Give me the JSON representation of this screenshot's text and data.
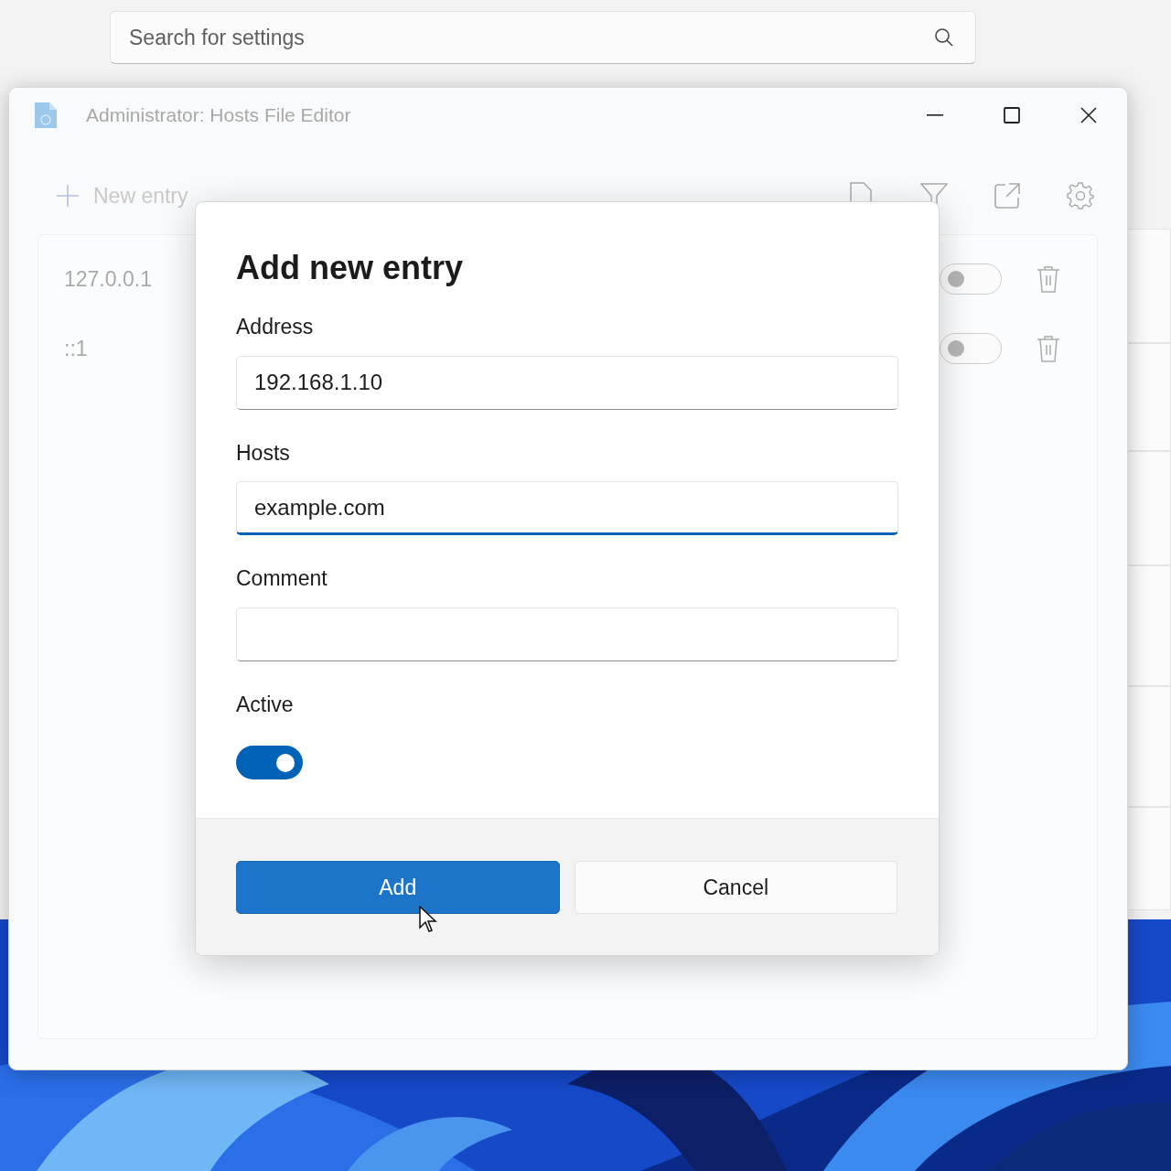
{
  "settings_search": {
    "placeholder": "Search for settings"
  },
  "window": {
    "title": "Administrator: Hosts File Editor"
  },
  "toolbar": {
    "new_entry": "New entry"
  },
  "entries": [
    {
      "address": "127.0.0.1",
      "active": false
    },
    {
      "address": "::1",
      "active": false
    }
  ],
  "dialog": {
    "title": "Add new entry",
    "fields": [
      {
        "label": "Address",
        "value": "192.168.1.10",
        "focused": false
      },
      {
        "label": "Hosts",
        "value": "example.com",
        "focused": true
      },
      {
        "label": "Comment",
        "focused": false
      }
    ],
    "active_label": "Active",
    "active": true,
    "buttons": [
      {
        "label": "Add",
        "kind": "primary"
      },
      {
        "label": "Cancel",
        "kind": "secondary"
      }
    ]
  }
}
